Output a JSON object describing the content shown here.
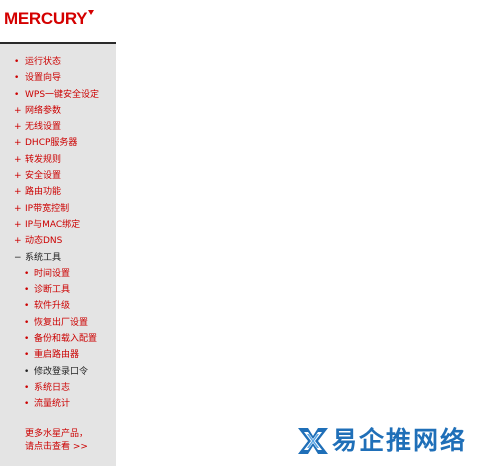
{
  "brand": {
    "logo_text": "MERCURY",
    "color": "#d40000"
  },
  "sidebar": {
    "items": [
      {
        "label": "运行状态"
      },
      {
        "label": "设置向导"
      },
      {
        "label": "WPS一键安全设定"
      },
      {
        "label": "网络参数"
      },
      {
        "label": "无线设置"
      },
      {
        "label": "DHCP服务器"
      },
      {
        "label": "转发规则"
      },
      {
        "label": "安全设置"
      },
      {
        "label": "路由功能"
      },
      {
        "label": "IP带宽控制"
      },
      {
        "label": "IP与MAC绑定"
      },
      {
        "label": "动态DNS"
      },
      {
        "label": "系统工具",
        "expanded": true
      }
    ],
    "subitems": [
      {
        "label": "时间设置"
      },
      {
        "label": "诊断工具"
      },
      {
        "label": "软件升级"
      },
      {
        "label": "恢复出厂设置"
      },
      {
        "label": "备份和载入配置"
      },
      {
        "label": "重启路由器"
      },
      {
        "label": "修改登录口令"
      },
      {
        "label": "系统日志"
      },
      {
        "label": "流量统计"
      }
    ],
    "more": {
      "line1": "更多水星产品，",
      "line2": "请点击查看 >>"
    },
    "bullet": "•",
    "bullet_plus": "+",
    "bullet_minus": "−",
    "link_color": "#cc0000",
    "background": "#e4e4e4"
  },
  "watermark": {
    "text": "易企推网络",
    "color": "#1f6fb8"
  }
}
